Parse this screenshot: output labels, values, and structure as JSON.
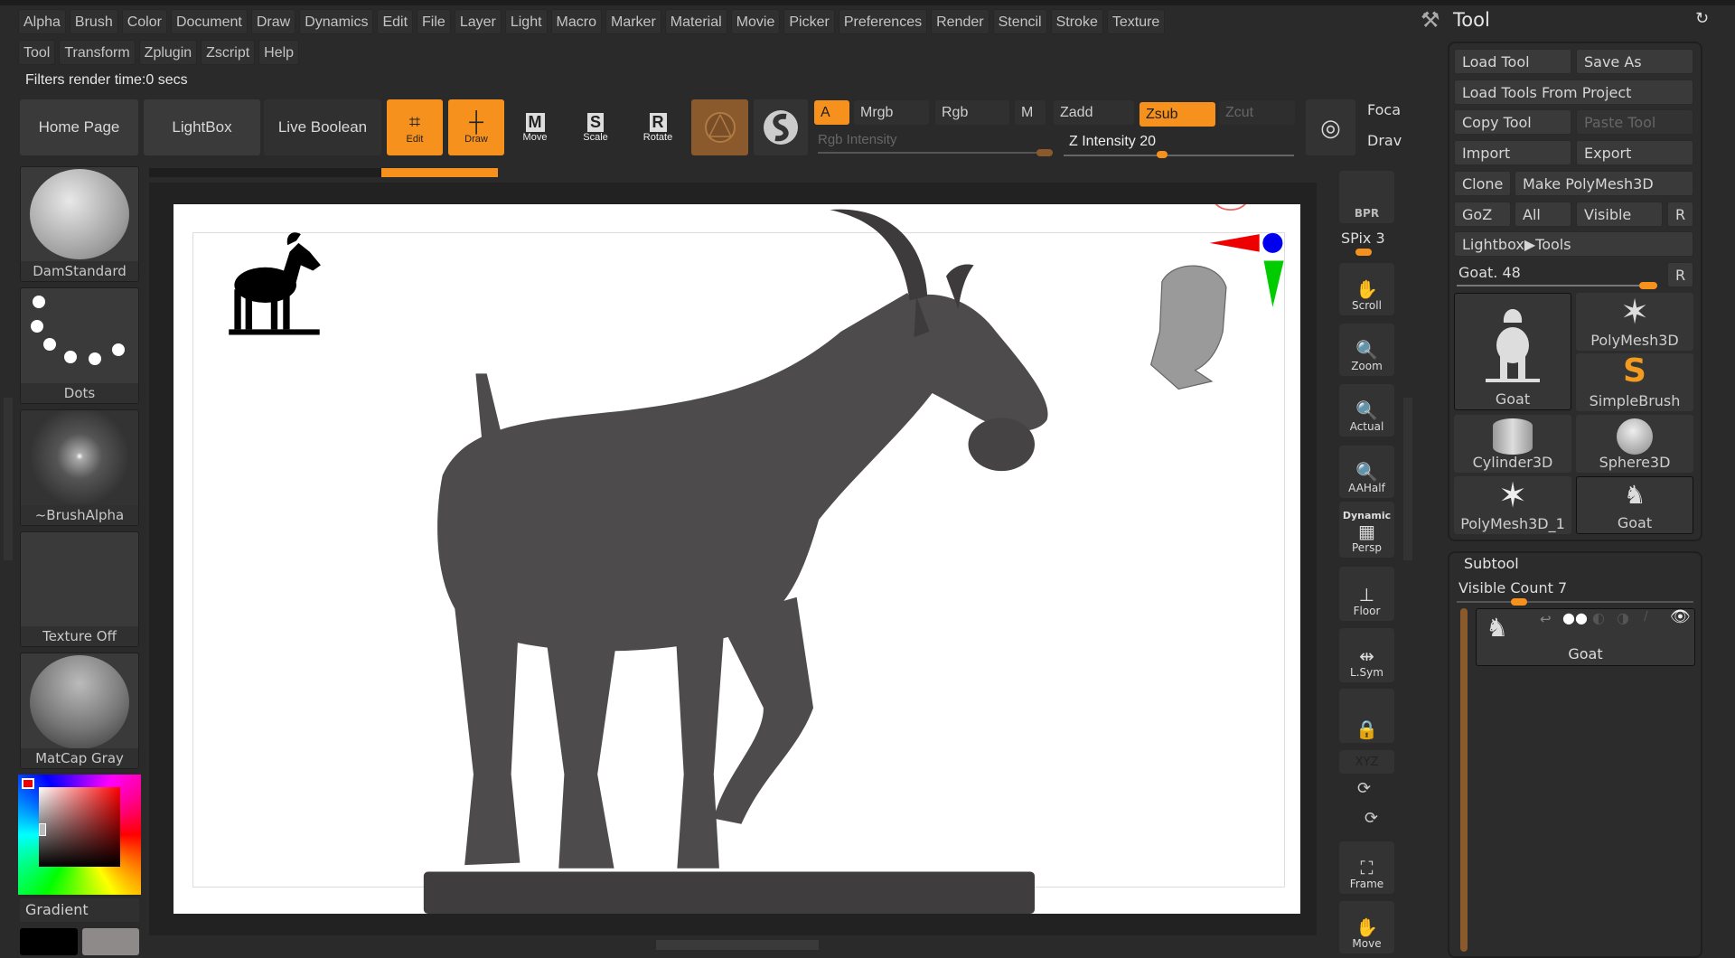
{
  "menu": {
    "row1": [
      "Alpha",
      "Brush",
      "Color",
      "Document",
      "Draw",
      "Dynamics",
      "Edit",
      "File",
      "Layer",
      "Light",
      "Macro",
      "Marker",
      "Material",
      "Movie",
      "Picker",
      "Preferences",
      "Render",
      "Stencil",
      "Stroke",
      "Texture"
    ],
    "row2": [
      "Tool",
      "Transform",
      "Zplugin",
      "Zscript",
      "Help"
    ]
  },
  "status_text": "Filters render time:0 secs",
  "toolbar": {
    "home_page": "Home Page",
    "lightbox": "LightBox",
    "live_boolean": "Live Boolean",
    "edit": "Edit",
    "draw": "Draw",
    "move": "Move",
    "scale": "Scale",
    "rotate": "Rotate",
    "a": "A",
    "mrgb": "Mrgb",
    "rgb": "Rgb",
    "m": "M",
    "zadd": "Zadd",
    "zsub": "Zsub",
    "zcut": "Zcut",
    "rgb_intensity": "Rgb Intensity",
    "z_intensity": "Z Intensity 20",
    "z_intensity_value": 20,
    "focal": "Foca",
    "draw_size": "Drav"
  },
  "left_shelf": {
    "brush": "DamStandard",
    "stroke": "Dots",
    "alpha": "~BrushAlpha",
    "texture": "Texture Off",
    "material": "MatCap Gray",
    "gradient": "Gradient"
  },
  "right_nav": {
    "bpr": "BPR",
    "spix": "SPix 3",
    "scroll": "Scroll",
    "zoom": "Zoom",
    "actual": "Actual",
    "aahalf": "AAHalf",
    "dynamic": "Dynamic",
    "persp": "Persp",
    "floor": "Floor",
    "lsym": "L.Sym",
    "xyz": "XYZ",
    "frame": "Frame",
    "move": "Move"
  },
  "tool_panel": {
    "title": "Tool",
    "load_tool": "Load Tool",
    "save_as": "Save As",
    "load_from_project": "Load Tools From Project",
    "copy_tool": "Copy Tool",
    "paste_tool": "Paste Tool",
    "import": "Import",
    "export": "Export",
    "clone": "Clone",
    "make_polymesh": "Make PolyMesh3D",
    "goz": "GoZ",
    "all": "All",
    "visible": "Visible",
    "r": "R",
    "lightbox_tools": "Lightbox▶Tools",
    "current_tool": "Goat. 48",
    "tools": [
      "Goat",
      "PolyMesh3D",
      "SimpleBrush",
      "Cylinder3D",
      "Sphere3D",
      "PolyMesh3D_1",
      "Goat"
    ]
  },
  "subtool": {
    "title": "Subtool",
    "visible_count": "Visible Count 7",
    "items": [
      "Goat"
    ]
  },
  "colors": {
    "accent": "#f7911e",
    "panel": "#2a2a2a",
    "button": "#3a3a3a"
  }
}
